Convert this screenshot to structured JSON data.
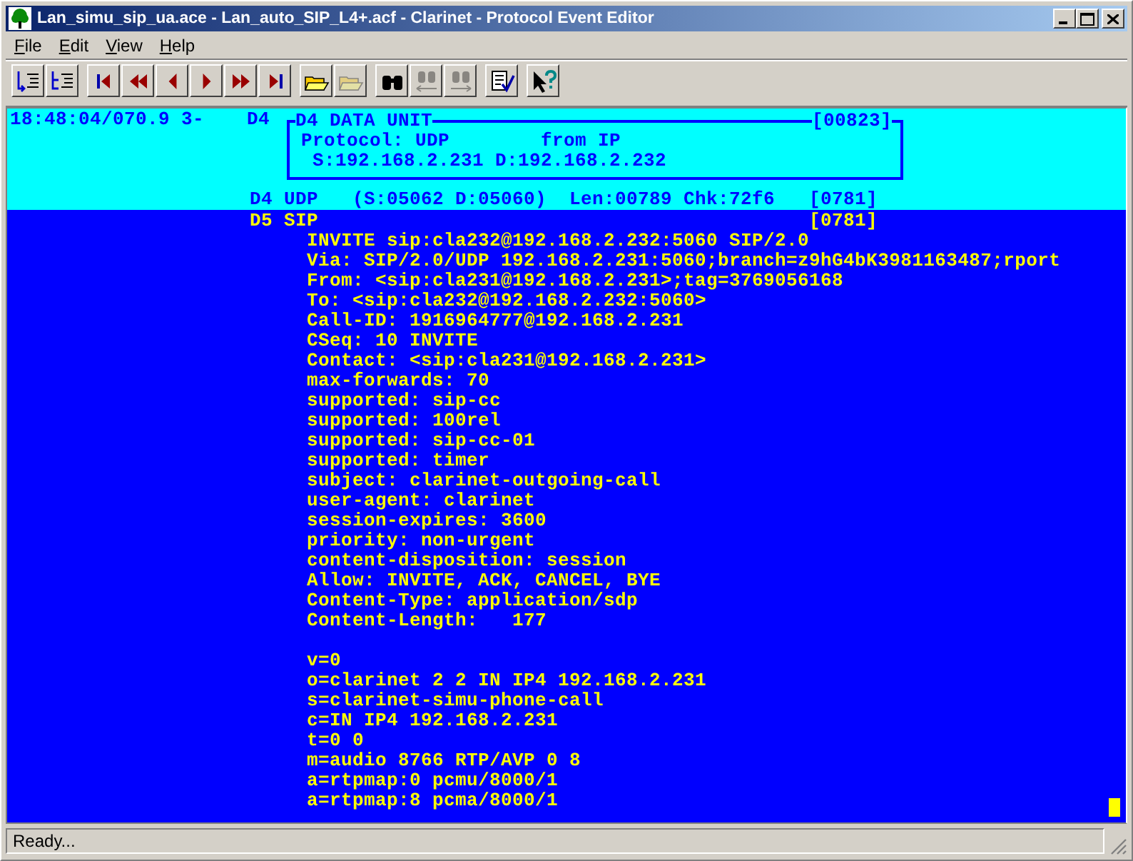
{
  "window": {
    "title": "Lan_simu_sip_ua.ace - Lan_auto_SIP_L4+.acf - Clarinet - Protocol Event Editor"
  },
  "menu": [
    "File",
    "Edit",
    "View",
    "Help"
  ],
  "toolbar": [
    [
      {
        "kind": "list-in",
        "disabled": false
      },
      {
        "kind": "list-out",
        "disabled": false
      }
    ],
    [
      {
        "kind": "first",
        "disabled": false
      },
      {
        "kind": "rewind",
        "disabled": false
      },
      {
        "kind": "prev",
        "disabled": false
      },
      {
        "kind": "next",
        "disabled": false
      },
      {
        "kind": "forward",
        "disabled": false
      },
      {
        "kind": "last",
        "disabled": false
      }
    ],
    [
      {
        "kind": "open",
        "disabled": false
      },
      {
        "kind": "open",
        "disabled": true
      }
    ],
    [
      {
        "kind": "find",
        "disabled": false
      },
      {
        "kind": "find-prev",
        "disabled": true
      },
      {
        "kind": "find-next",
        "disabled": true
      }
    ],
    [
      {
        "kind": "check",
        "disabled": false
      }
    ],
    [
      {
        "kind": "help",
        "disabled": false
      }
    ]
  ],
  "event": {
    "timestamp": "18:48:04/070.9 3-",
    "layer": "D4",
    "data_unit": {
      "title": "D4 DATA UNIT",
      "count": "[00823]",
      "lines": [
        "Protocol: UDP        from IP",
        " S:192.168.2.231 D:192.168.2.232"
      ]
    },
    "udp": {
      "label": "D4 UDP   (S:05062 D:05060)  Len:00789 Chk:72f6",
      "count": "[0781]"
    },
    "sip": {
      "label": "D5 SIP",
      "count": "[0781]",
      "headers": [
        "INVITE sip:cla232@192.168.2.232:5060 SIP/2.0",
        "Via: SIP/2.0/UDP 192.168.2.231:5060;branch=z9hG4bK3981163487;rport",
        "From: <sip:cla231@192.168.2.231>;tag=3769056168",
        "To: <sip:cla232@192.168.2.232:5060>",
        "Call-ID: 1916964777@192.168.2.231",
        "CSeq: 10 INVITE",
        "Contact: <sip:cla231@192.168.2.231>",
        "max-forwards: 70",
        "supported: sip-cc",
        "supported: 100rel",
        "supported: sip-cc-01",
        "supported: timer",
        "subject: clarinet-outgoing-call",
        "user-agent: clarinet",
        "session-expires: 3600",
        "priority: non-urgent",
        "content-disposition: session",
        "Allow: INVITE, ACK, CANCEL, BYE",
        "Content-Type: application/sdp",
        "Content-Length:   177"
      ],
      "body": [
        "v=0",
        "o=clarinet 2 2 IN IP4 192.168.2.231",
        "s=clarinet-simu-phone-call",
        "c=IN IP4 192.168.2.231",
        "t=0 0",
        "m=audio 8766 RTP/AVP 0 8",
        "a=rtpmap:0 pcmu/8000/1",
        "a=rtpmap:8 pcma/8000/1"
      ]
    }
  },
  "status_bar": {
    "text": "Ready..."
  }
}
